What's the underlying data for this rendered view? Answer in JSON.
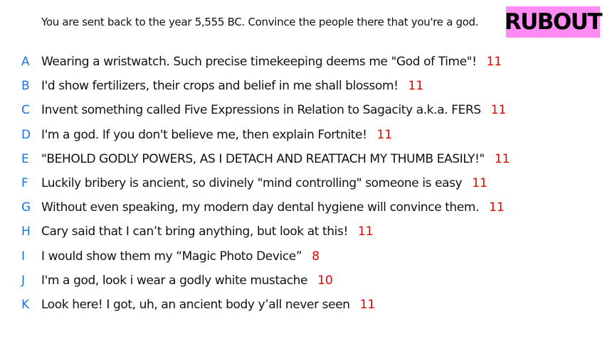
{
  "prompt": "You are sent back to the year 5,555 BC. Convince the people there that you're a god.",
  "badge": "RUBOUT",
  "colors": {
    "letter": "#1a73e8",
    "score": "#e00000",
    "badge_bg": "#ff8cf2"
  },
  "answers": [
    {
      "letter": "A",
      "text": "Wearing a wristwatch. Such precise timekeeping deems me \"God of Time\"!",
      "score": "11"
    },
    {
      "letter": "B",
      "text": "I'd show fertilizers, their crops and belief in me shall blossom!",
      "score": "11"
    },
    {
      "letter": "C",
      "text": "Invent something called Five Expressions in Relation to Sagacity a.k.a. FERS",
      "score": "11"
    },
    {
      "letter": "D",
      "text": "I'm a god. If you don't believe me, then explain Fortnite!",
      "score": "11"
    },
    {
      "letter": "E",
      "text": "\"BEHOLD GODLY POWERS, AS I DETACH AND REATTACH MY THUMB EASILY!\"",
      "score": "11"
    },
    {
      "letter": "F",
      "text": "Luckily bribery is ancient, so divinely \"mind controlling\" someone is easy",
      "score": "11"
    },
    {
      "letter": "G",
      "text": "Without even speaking, my modern day dental hygiene will convince them.",
      "score": "11"
    },
    {
      "letter": "H",
      "text": "Cary said that I can’t bring anything, but look at this!",
      "score": "11"
    },
    {
      "letter": "I",
      "text": "I would show them my “Magic Photo Device”",
      "score": "8"
    },
    {
      "letter": "J",
      "text": "I'm a god, look i wear a godly white mustache",
      "score": "10"
    },
    {
      "letter": "K",
      "text": "Look here! I got, uh, an ancient body y’all never seen",
      "score": "11"
    }
  ]
}
